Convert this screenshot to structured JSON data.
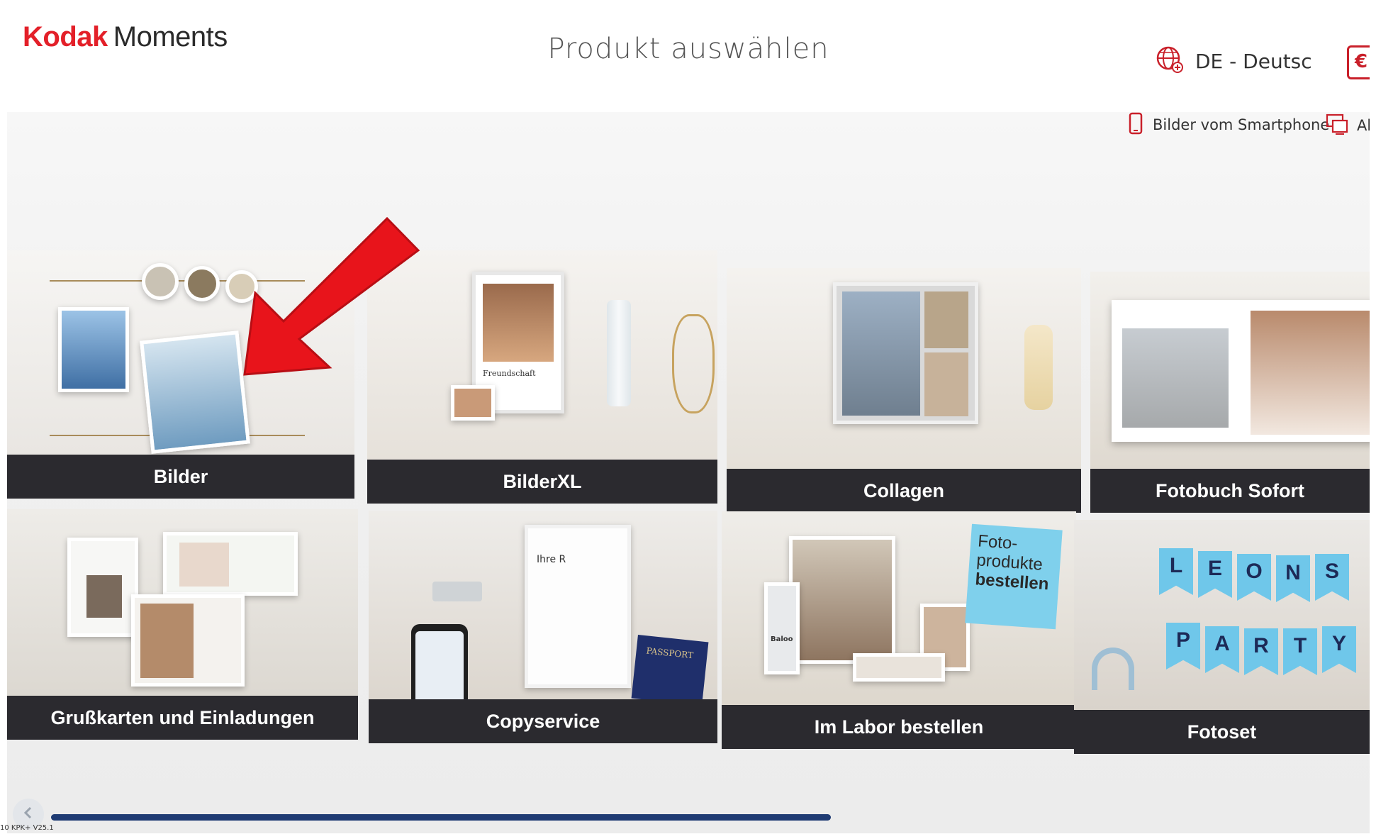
{
  "header": {
    "brand": "Kodak",
    "brand_suffix": "Moments",
    "title": "Produkt auswählen",
    "language": "DE - Deutsc",
    "currency_symbol": "€",
    "smartphone_link": "Bilder vom Smartphone",
    "other_link": "Ab"
  },
  "tiles": [
    {
      "label": "Bilder"
    },
    {
      "label": "BilderXL"
    },
    {
      "label": "Collagen"
    },
    {
      "label": "Fotobuch Sofort"
    },
    {
      "label": "Grußkarten und Einladungen"
    },
    {
      "label": "Copyservice"
    },
    {
      "label": "Im Labor bestellen"
    },
    {
      "label": "Fotoset"
    }
  ],
  "badge": {
    "line1": "Foto-",
    "line2": "produkte",
    "line3": "bestellen"
  },
  "bilderxl_card_text": "Freundschaft",
  "copyservice_doc_text": "Ihre R",
  "passport_text": "PASSPORT",
  "bottle_label": "Baloo",
  "banner_top": [
    "L",
    "E",
    "O",
    "N",
    "S"
  ],
  "banner_bottom": [
    "P",
    "A",
    "R",
    "T",
    "Y"
  ],
  "version": "10 KPK+ V25.1",
  "colors": {
    "brand_red": "#e32029",
    "caption_bg": "#2b2a2f",
    "badge_blue": "#7fd0ec",
    "scroll_thumb": "#1f3b73",
    "arrow_red": "#e8141b"
  },
  "icons": {
    "language": "globe-plus-icon",
    "currency": "euro-icon",
    "smartphone": "smartphone-icon",
    "computer": "monitor-icon",
    "scroll_left": "chevron-left-icon"
  }
}
